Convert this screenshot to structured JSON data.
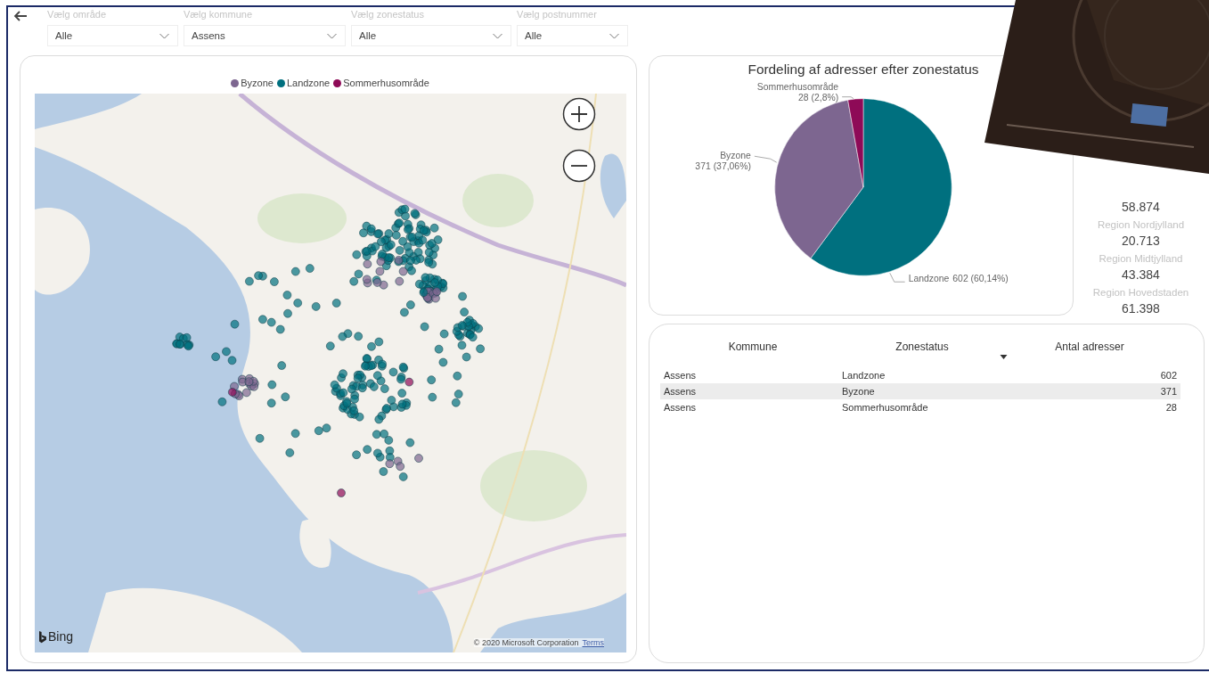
{
  "filters": [
    {
      "label": "Vælg område",
      "value": "Alle"
    },
    {
      "label": "Vælg kommune",
      "value": "Assens"
    },
    {
      "label": "Vælg zonestatus",
      "value": "Alle"
    },
    {
      "label": "Vælg postnummer",
      "value": "Alle"
    }
  ],
  "map": {
    "legend": [
      {
        "label": "Byzone",
        "color": "#7d6690"
      },
      {
        "label": "Landzone",
        "color": "#00707f"
      },
      {
        "label": "Sommerhusområde",
        "color": "#8e0a57"
      }
    ],
    "logo_text": "Bing",
    "copyright": "© 2020 Microsoft Corporation",
    "terms_link": "Terms"
  },
  "pie": {
    "chart_data": {
      "type": "pie",
      "title": "Fordeling af adresser efter zonestatus",
      "categories": [
        "Landzone",
        "Byzone",
        "Sommerhusområde"
      ],
      "values": [
        602,
        371,
        28
      ],
      "colors": [
        "#00707f",
        "#7d6690",
        "#8e0a57"
      ],
      "data_labels": true,
      "value_labels": [
        "602 (60,14%)",
        "371 (37,06%)",
        "28 (2,8%)"
      ]
    }
  },
  "stats": [
    {
      "value": "58.874"
    },
    {
      "label": "Region Nordjylland",
      "value": "20.713"
    },
    {
      "label": "Region Midtjylland",
      "value": "43.384"
    },
    {
      "label": "Region Hovedstaden",
      "value": "61.398"
    }
  ],
  "table": {
    "columns": [
      {
        "label": "Kommune",
        "sorted": false
      },
      {
        "label": "Zonestatus",
        "sorted": true
      },
      {
        "label": "Antal adresser",
        "sorted": false
      }
    ],
    "rows": [
      {
        "cells": [
          "Assens",
          "Landzone",
          "602"
        ],
        "selected": false
      },
      {
        "cells": [
          "Assens",
          "Byzone",
          "371"
        ],
        "selected": true
      },
      {
        "cells": [
          "Assens",
          "Sommerhusområde",
          "28"
        ],
        "selected": false
      }
    ]
  }
}
